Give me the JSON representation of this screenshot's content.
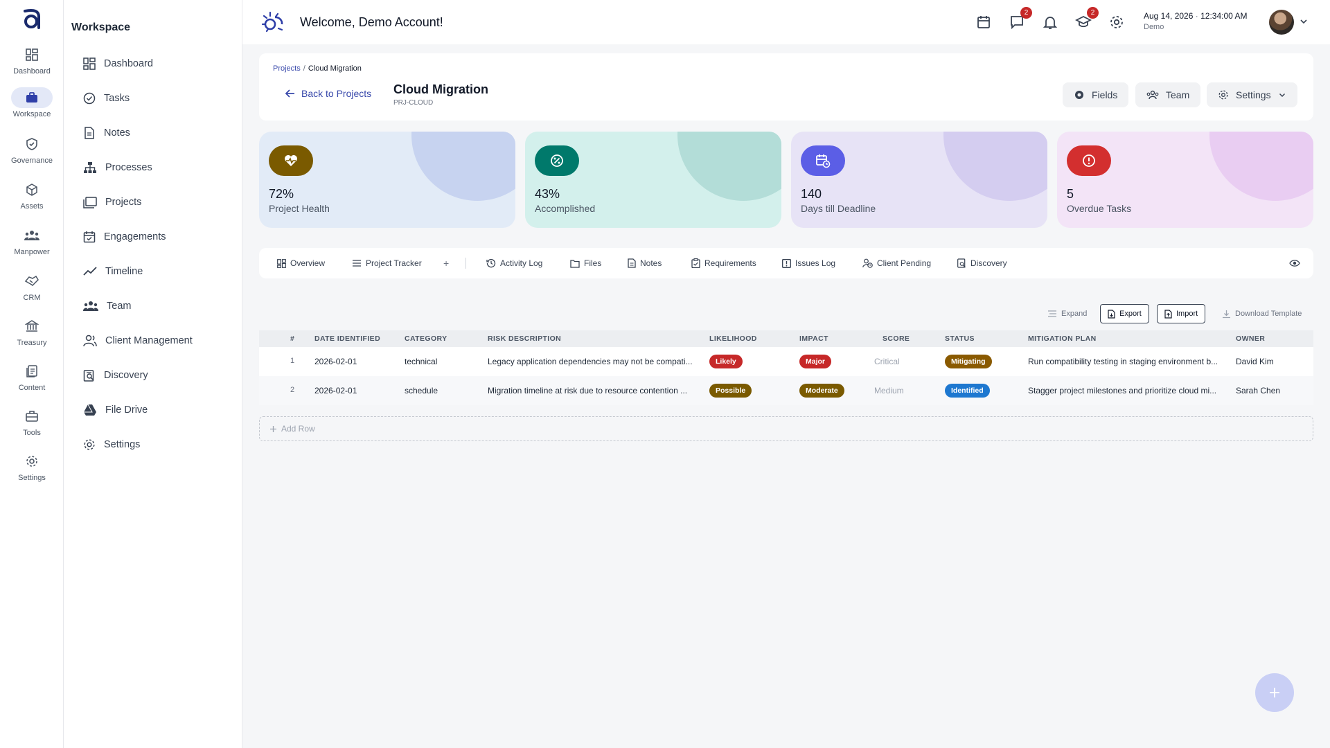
{
  "rail": {
    "items": [
      {
        "label": "Dashboard",
        "icon": "dashboard-icon"
      },
      {
        "label": "Workspace",
        "icon": "briefcase-icon"
      },
      {
        "label": "Governance",
        "icon": "shield-check-icon"
      },
      {
        "label": "Assets",
        "icon": "cube-icon"
      },
      {
        "label": "Manpower",
        "icon": "people-icon"
      },
      {
        "label": "CRM",
        "icon": "handshake-icon"
      },
      {
        "label": "Treasury",
        "icon": "bank-icon"
      },
      {
        "label": "Content",
        "icon": "document-icon"
      },
      {
        "label": "Tools",
        "icon": "toolbox-icon"
      },
      {
        "label": "Settings",
        "icon": "gear-icon"
      }
    ]
  },
  "sidebar": {
    "title": "Workspace",
    "items": [
      {
        "label": "Dashboard",
        "icon": "grid-icon"
      },
      {
        "label": "Tasks",
        "icon": "check-circle-icon"
      },
      {
        "label": "Notes",
        "icon": "note-icon"
      },
      {
        "label": "Processes",
        "icon": "hierarchy-icon"
      },
      {
        "label": "Projects",
        "icon": "folders-icon"
      },
      {
        "label": "Engagements",
        "icon": "calendar-check-icon"
      },
      {
        "label": "Timeline",
        "icon": "trend-icon"
      },
      {
        "label": "Team",
        "icon": "team-icon"
      },
      {
        "label": "Client Management",
        "icon": "client-icon"
      },
      {
        "label": "Discovery",
        "icon": "discovery-icon"
      },
      {
        "label": "File Drive",
        "icon": "drive-icon"
      },
      {
        "label": "Settings",
        "icon": "gear-icon"
      }
    ]
  },
  "header": {
    "welcome": "Welcome, Demo Account!",
    "date": "Aug 14, 2026",
    "time": "12:34:00 AM",
    "user": "Demo",
    "chat_badge": "2",
    "course_badge": "2"
  },
  "project": {
    "breadcrumb_parent": "Projects",
    "breadcrumb_sep": "/",
    "breadcrumb_current": "Cloud Migration",
    "back_label": "Back to Projects",
    "title": "Cloud Migration",
    "code": "PRJ-CLOUD",
    "buttons": {
      "fields": "Fields",
      "team": "Team",
      "settings": "Settings"
    }
  },
  "stats": [
    {
      "value": "72%",
      "caption": "Project Health",
      "bg": "#e2ebf7",
      "blob": "#c7d3f0",
      "icon_bg": "#7a5a00",
      "icon": "heart-pulse-icon"
    },
    {
      "value": "43%",
      "caption": "Accomplished",
      "bg": "#d3f0ec",
      "blob": "#b3ddd8",
      "icon_bg": "#00796b",
      "icon": "percent-icon"
    },
    {
      "value": "140",
      "caption": "Days till Deadline",
      "bg": "#e7e3f6",
      "blob": "#d4cdf0",
      "icon_bg": "#5b5ee6",
      "icon": "calendar-clock-icon"
    },
    {
      "value": "5",
      "caption": "Overdue Tasks",
      "bg": "#f3e4f7",
      "blob": "#e9cdf2",
      "icon_bg": "#d32f2f",
      "icon": "alert-circle-icon"
    }
  ],
  "tabs": [
    {
      "label": "Overview",
      "icon": "overview-icon"
    },
    {
      "label": "Project Tracker",
      "icon": "list-icon"
    },
    {
      "label": "+",
      "icon": ""
    },
    {
      "label": "Activity Log",
      "icon": "history-icon"
    },
    {
      "label": "Files",
      "icon": "files-icon"
    },
    {
      "label": "Notes",
      "icon": "note-icon"
    },
    {
      "label": "Requirements",
      "icon": "clipboard-icon"
    },
    {
      "label": "Issues Log",
      "icon": "issue-icon"
    },
    {
      "label": "Client Pending",
      "icon": "client-pending-icon"
    },
    {
      "label": "Discovery",
      "icon": "discovery-icon"
    }
  ],
  "toolbar": {
    "expand": "Expand",
    "export": "Export",
    "import": "Import",
    "download_template": "Download Template"
  },
  "table": {
    "headers": [
      "#",
      "DATE IDENTIFIED",
      "CATEGORY",
      "RISK DESCRIPTION",
      "LIKELIHOOD",
      "IMPACT",
      "SCORE",
      "STATUS",
      "MITIGATION PLAN",
      "OWNER"
    ],
    "rows": [
      {
        "num": "1",
        "date": "2026-02-01",
        "category": "technical",
        "description": "Legacy application dependencies may not be compati...",
        "likelihood": "Likely",
        "likelihood_color": "#c62828",
        "impact": "Major",
        "impact_color": "#c62828",
        "score": "Critical",
        "status": "Mitigating",
        "status_color": "#8a5a00",
        "mitigation": "Run compatibility testing in staging environment b...",
        "owner": "David Kim"
      },
      {
        "num": "2",
        "date": "2026-02-01",
        "category": "schedule",
        "description": "Migration timeline at risk due to resource contention ...",
        "likelihood": "Possible",
        "likelihood_color": "#7a5a00",
        "impact": "Moderate",
        "impact_color": "#7a5a00",
        "score": "Medium",
        "status": "Identified",
        "status_color": "#1e78d0",
        "mitigation": "Stagger project milestones and prioritize cloud mi...",
        "owner": "Sarah Chen"
      }
    ],
    "add_row": "Add Row"
  }
}
